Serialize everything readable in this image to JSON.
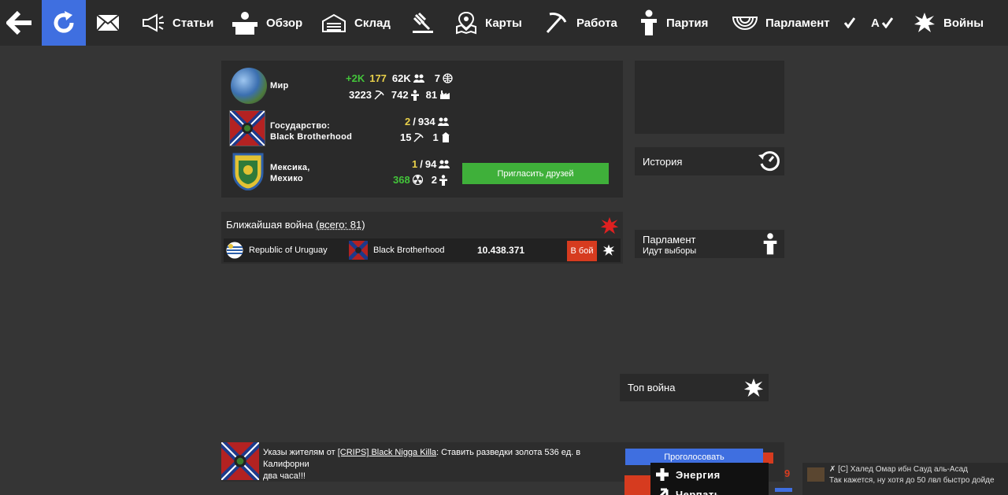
{
  "nav": {
    "articles": "Статьи",
    "overview": "Обзор",
    "storage": "Склад",
    "maps": "Карты",
    "work": "Работа",
    "party": "Партия",
    "parliament": "Парламент",
    "lang": "A",
    "wars": "Войны"
  },
  "stats": {
    "world": {
      "title": "Мир",
      "delta": "+2K",
      "online": "177",
      "population": "62K",
      "states": "7",
      "workers": "3223",
      "parties": "742",
      "factories": "81"
    },
    "state": {
      "title_line1": "Государство:",
      "title_line2": "Black Brotherhood",
      "online": "2",
      "population": "934",
      "workers": "15",
      "buildings": "1"
    },
    "region": {
      "title_line1": "Мексика,",
      "title_line2": "Мехико",
      "online": "1",
      "population": "94",
      "nuclear": "368",
      "parties": "2"
    },
    "invite_label": "Пригласить друзей"
  },
  "war": {
    "header_prefix": "Ближайшая война",
    "header_total": "(всего: 81)",
    "attacker": "Republic of Uruguay",
    "defender": "Black Brotherhood",
    "damage": "10.438.371",
    "fight_label": "В бой"
  },
  "side": {
    "history": "История",
    "parliament_title": "Парламент",
    "parliament_sub": "Идут выборы",
    "top_war": "Топ война"
  },
  "decree": {
    "prefix": "Указы жителям от ",
    "author": "[CRIPS] Black Nigga Killa",
    "text": ": Ставить разведки золота 536 ед. в Калифорни",
    "line2": "два часа!!!",
    "vote_label": "Проголосовать"
  },
  "dropdown": {
    "energy": "Энергия",
    "second": "Черпать"
  },
  "chat": {
    "line1": "✗ [С] Халед Омар ибн Сауд аль-Асад",
    "line2": "Так кажется, ну хотя до 50 лвл быстро дойде"
  },
  "colors": {
    "accent_blue": "#3f6fe0",
    "invite_green": "#3fb03a",
    "fight_red": "#d63b1f"
  }
}
